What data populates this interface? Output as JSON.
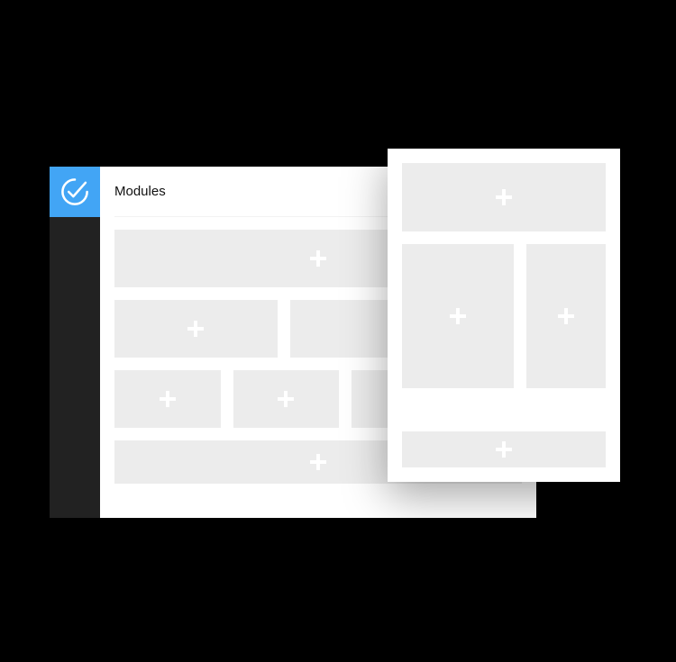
{
  "header": {
    "title": "Modules"
  },
  "brand": {
    "accent": "#42a5f5",
    "sidebar_bg": "#222222",
    "block_bg": "#ececec"
  },
  "icons": {
    "logo": "check-circle"
  }
}
